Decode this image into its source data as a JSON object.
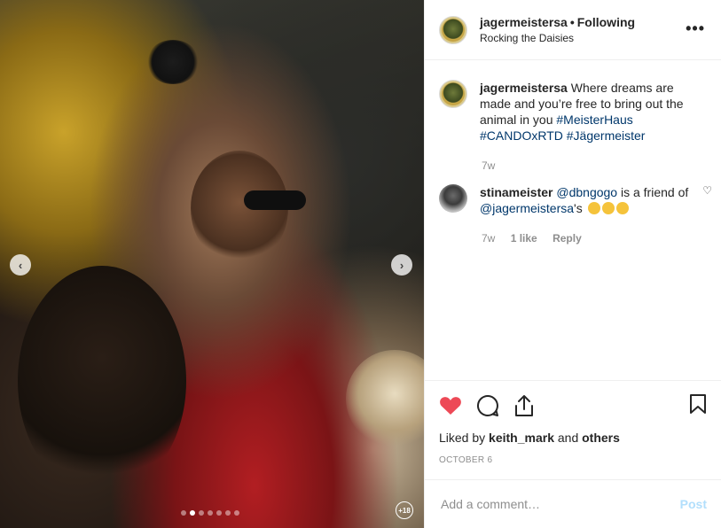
{
  "header": {
    "username": "jagermeistersa",
    "separator": "•",
    "follow_status": "Following",
    "location": "Rocking the Daisies",
    "more_icon": "more-options-icon"
  },
  "caption": {
    "username": "jagermeistersa",
    "text": "Where dreams are made and you’re free to bring out the animal in you",
    "hashtags": [
      "#MeisterHaus",
      "#CANDOxRTD",
      "#Jägermeister"
    ],
    "age": "7w"
  },
  "comment": {
    "username": "stinameister",
    "mention1": "@dbngogo",
    "mid_text": "is a friend of",
    "mention2": "@jagermeistersa",
    "suffix": "'s",
    "age": "7w",
    "likes": "1 like",
    "reply": "Reply"
  },
  "actions": {
    "liked_prefix": "Liked by",
    "liked_user": "keith_mark",
    "liked_and": "and",
    "liked_others": "others",
    "date": "OCTOBER 6",
    "like_color": "#ed4956"
  },
  "add_comment": {
    "placeholder": "Add a comment…",
    "post_label": "Post"
  },
  "media": {
    "carousel_badge": "+18",
    "dot_count": 7,
    "active_dot": 2
  }
}
